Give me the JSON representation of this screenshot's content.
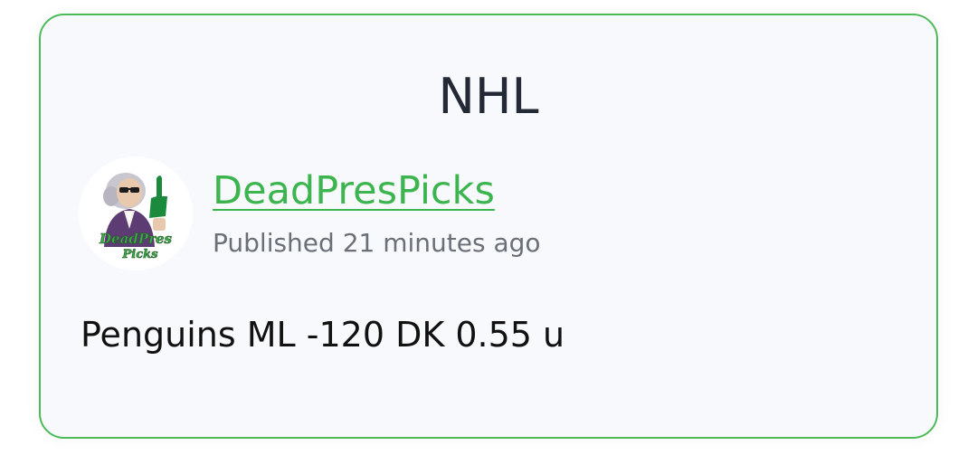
{
  "card": {
    "league": "NHL",
    "author": {
      "name": "DeadPresPicks",
      "avatar_text": "Dead Pres Picks",
      "avatar_icon": "founding-father-with-foam-finger"
    },
    "published": "Published 21 minutes ago",
    "pick": "Penguins ML -120 DK 0.55 u",
    "colors": {
      "border": "#4cbb59",
      "link": "#3cb54f",
      "background": "#f8f9fc"
    }
  }
}
